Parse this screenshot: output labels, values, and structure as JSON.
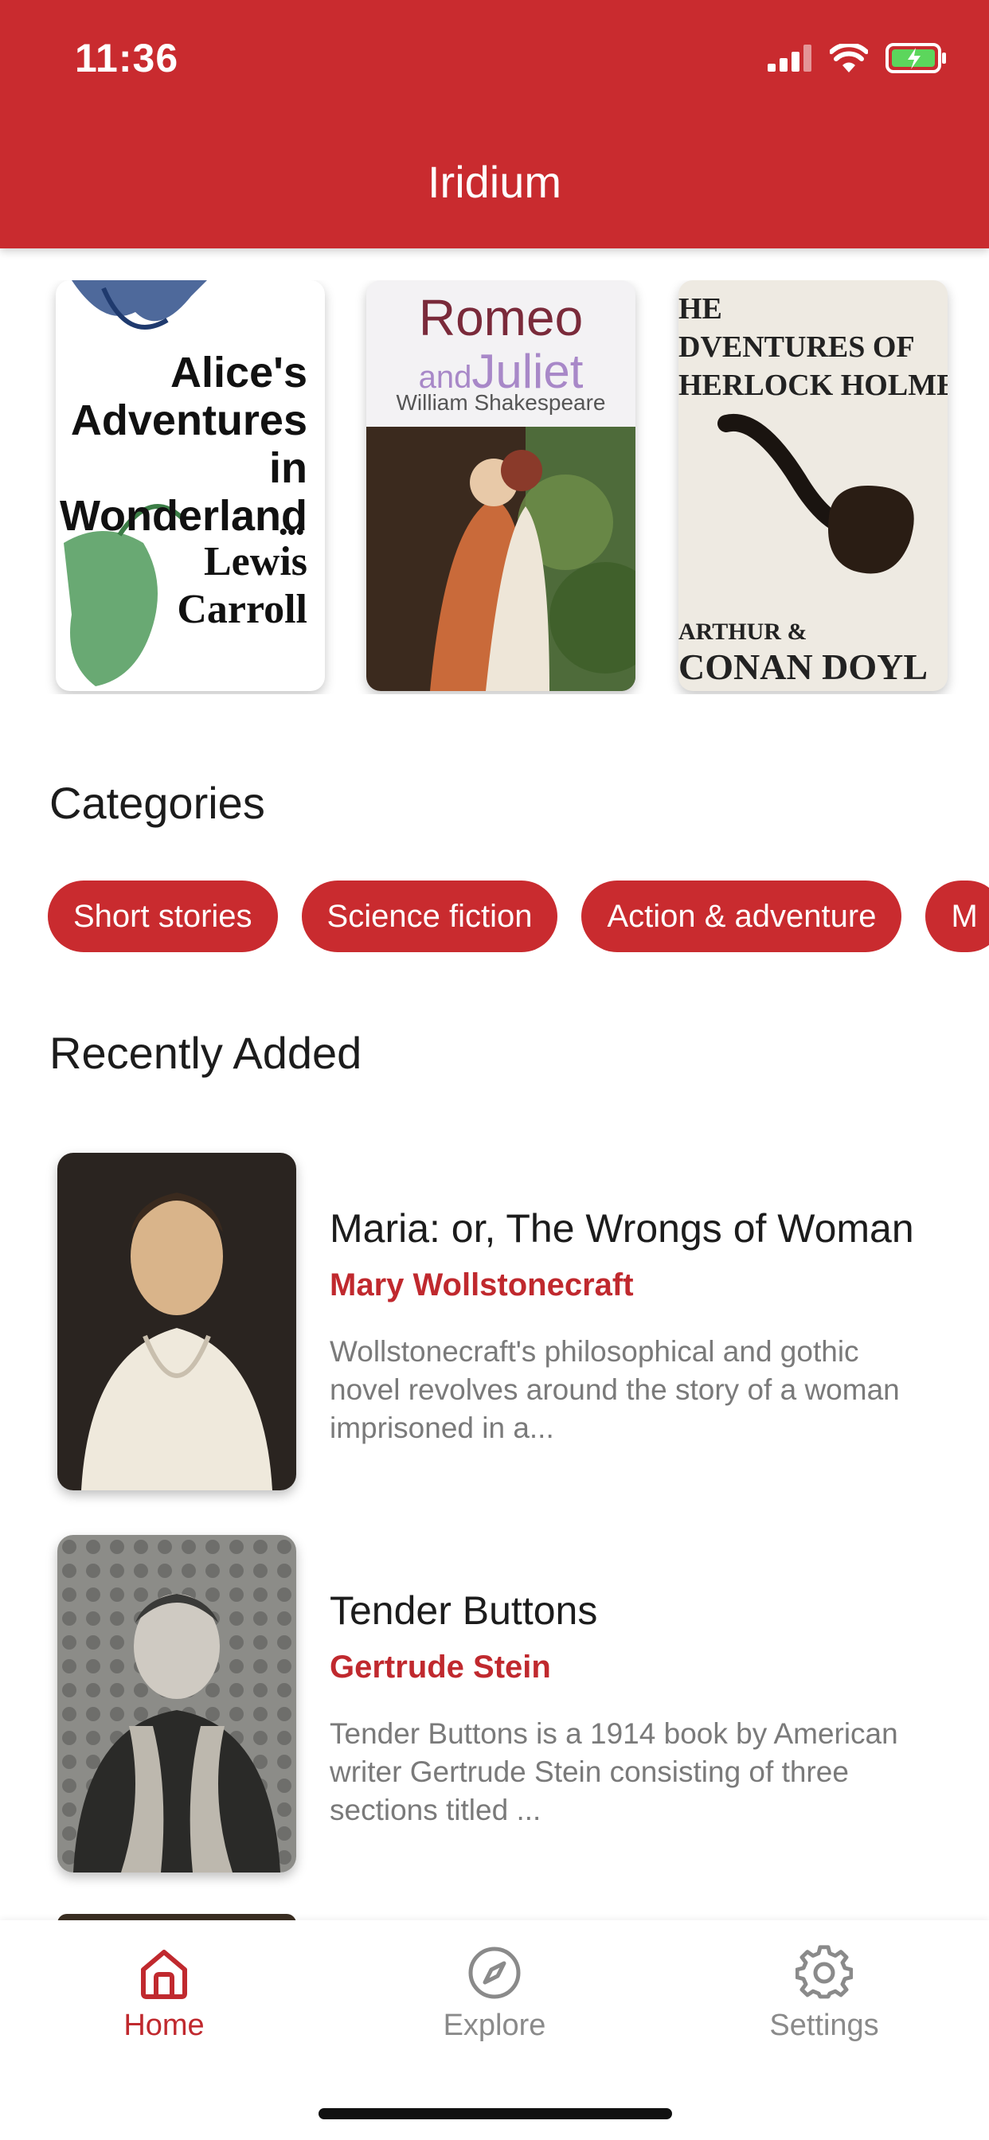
{
  "status_bar": {
    "time": "11:36"
  },
  "header": {
    "title": "Iridium"
  },
  "carousel": [
    {
      "title_lines": [
        "Alice's",
        "Adventures in",
        "Wonderland"
      ],
      "author_lines": [
        "Lewis",
        "Carroll"
      ]
    },
    {
      "title_top": "Romeo",
      "title_and": "and",
      "title_second": "Juliet",
      "author": "William Shakespeare"
    },
    {
      "title_lines": [
        "HE",
        "DVENTURES OF",
        "HERLOCK HOLME"
      ],
      "author_lines": [
        "ARTHUR &",
        "CONAN DOYL"
      ]
    }
  ],
  "categories": {
    "title": "Categories",
    "items": [
      "Short stories",
      "Science fiction",
      "Action & adventure",
      "M"
    ]
  },
  "recent": {
    "title": "Recently Added",
    "items": [
      {
        "title": "Maria: or, The Wrongs of Woman",
        "author": "Mary Wollstonecraft",
        "description": "Wollstonecraft's philosophical and gothic novel revolves around the story of a woman imprisoned in a..."
      },
      {
        "title": "Tender Buttons",
        "author": "Gertrude Stein",
        "description": "Tender Buttons is a 1914 book by American writer Gertrude Stein consisting of three sections titled ..."
      }
    ]
  },
  "nav": {
    "items": [
      {
        "label": "Home",
        "icon": "home-icon",
        "active": true
      },
      {
        "label": "Explore",
        "icon": "compass-icon",
        "active": false
      },
      {
        "label": "Settings",
        "icon": "gear-icon",
        "active": false
      }
    ]
  },
  "colors": {
    "accent": "#c92b2f",
    "muted": "#8a8a8a",
    "text": "#1c1c1c"
  }
}
